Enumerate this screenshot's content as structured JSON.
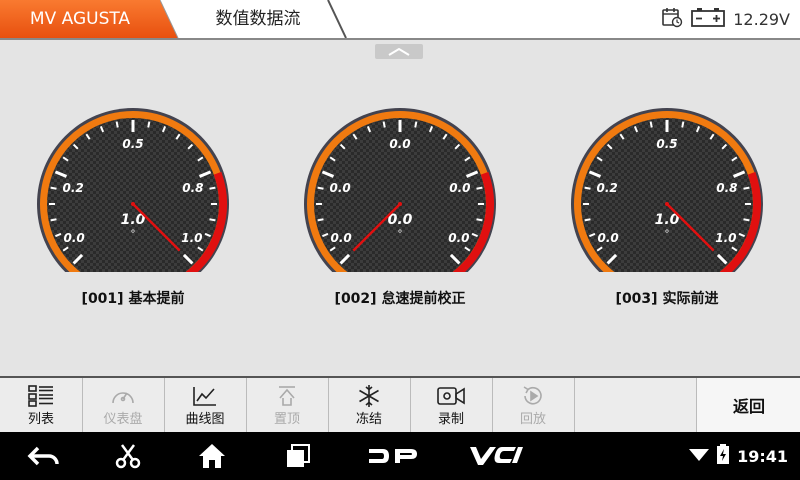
{
  "header": {
    "brand": "MV AGUSTA",
    "page_title": "数值数据流",
    "voltage": "12.29V",
    "icons": [
      "calendar-clock-icon",
      "battery-icon"
    ]
  },
  "gauges": [
    {
      "caption": "[001] 基本提前",
      "value_label": "1.0",
      "unit": "°",
      "value": 1.0,
      "ticks": [
        "0.0",
        "0.2",
        "0.5",
        "0.8",
        "1.0"
      ]
    },
    {
      "caption": "[002] 怠速提前校正",
      "value_label": "0.0",
      "unit": "°",
      "value": 0.0,
      "ticks": [
        "0.0",
        "0.0",
        "0.0",
        "0.0",
        "0.0"
      ]
    },
    {
      "caption": "[003] 实际前进",
      "value_label": "1.0",
      "unit": "°",
      "value": 1.0,
      "ticks": [
        "0.0",
        "0.2",
        "0.5",
        "0.8",
        "1.0"
      ]
    }
  ],
  "toolbar": {
    "items": [
      {
        "label": "列表",
        "icon": "list-icon",
        "enabled": true
      },
      {
        "label": "仪表盘",
        "icon": "dashboard-icon",
        "enabled": false
      },
      {
        "label": "曲线图",
        "icon": "line-chart-icon",
        "enabled": true
      },
      {
        "label": "置顶",
        "icon": "pin-top-icon",
        "enabled": false
      },
      {
        "label": "冻结",
        "icon": "snowflake-icon",
        "enabled": true
      },
      {
        "label": "录制",
        "icon": "record-icon",
        "enabled": true
      },
      {
        "label": "回放",
        "icon": "playback-icon",
        "enabled": false
      }
    ],
    "back_label": "返回"
  },
  "navbar": {
    "time": "19:41",
    "icons": [
      "back-icon",
      "scissors-icon",
      "home-icon",
      "recent-apps-icon",
      "dp-logo",
      "vci-logo",
      "wifi-icon",
      "battery-charging-icon"
    ]
  },
  "colors": {
    "brand_orange": "#f05a1a",
    "gauge_orange": "#f07a10",
    "needle_red": "#e01010"
  }
}
